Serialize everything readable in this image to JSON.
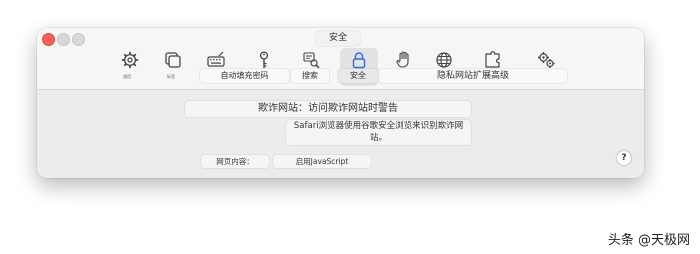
{
  "window": {
    "title": "安全"
  },
  "toolbar": {
    "tiny_labels": {
      "general": "通用",
      "tabs": "标签"
    },
    "labels": {
      "autofill_passwords": "自动填充密码",
      "search": "搜索",
      "security": "安全",
      "privacy_websites_extensions_advanced": "隐私网站扩展高级"
    }
  },
  "content": {
    "fraud_setting": "欺诈网站：访问欺诈网站时警告",
    "fraud_description": "Safari浏览器使用谷歌安全浏览来识别欺诈网站。",
    "web_content_label": "网页内容：",
    "enable_js": "启用JavaScript",
    "help_label": "?"
  },
  "watermark": "头条 @天极网",
  "icons": {
    "general": "gear-icon",
    "tabs": "tabs-icon",
    "autofill": "keyboard-icon",
    "passwords": "key-icon",
    "search": "search-icon",
    "security": "lock-icon",
    "privacy": "hand-icon",
    "websites": "globe-icon",
    "extensions": "puzzle-icon",
    "advanced": "gears-icon"
  },
  "colors": {
    "window_bg": "#ececec",
    "toolbar_bg": "#f6f6f6",
    "accent": "#2f6be8",
    "close": "#fd5f57"
  }
}
